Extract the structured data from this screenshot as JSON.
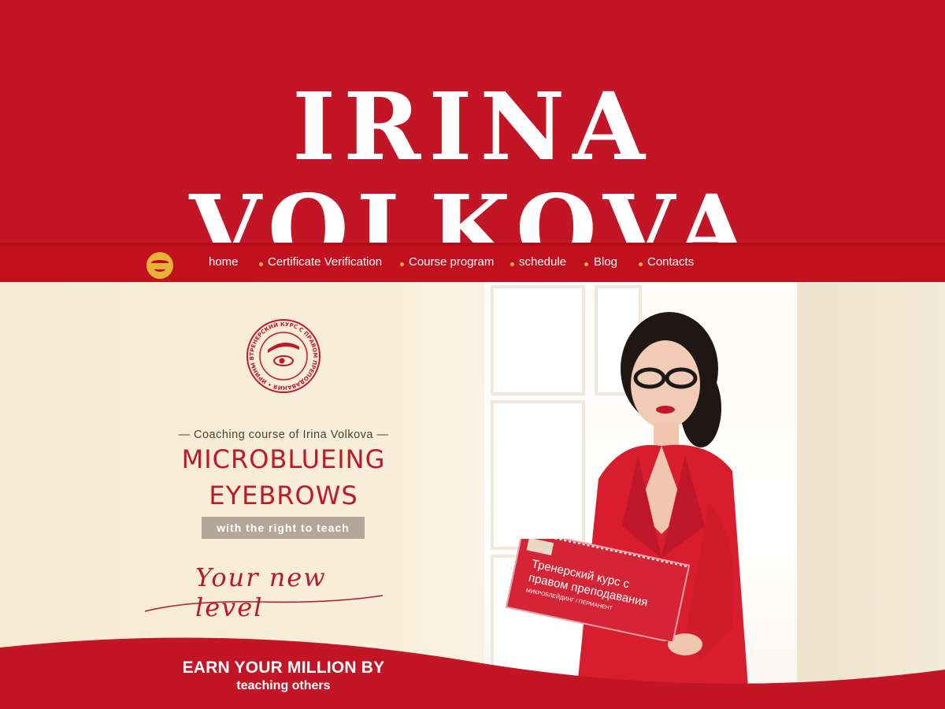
{
  "banner": {
    "title": "Irina Volkova"
  },
  "nav": {
    "logo_icon": "eyebrow-eye-icon",
    "items": [
      {
        "label": "home"
      },
      {
        "label": "Certificate Verification"
      },
      {
        "label": "Course program"
      },
      {
        "label": "schedule"
      },
      {
        "label": "Blog"
      },
      {
        "label": "Contacts"
      }
    ]
  },
  "hero": {
    "stamp_text": "ТРЕНЕРСКИЙ КУРС С ПРАВОМ ПРЕПОДАВАНИЯ • ИРИНЫ ВОЛКОВОЙ •",
    "subtitle": "— Coaching course of Irina Volkova —",
    "title_line1": "MICROBLUEING",
    "title_line2": "EYEBROWS",
    "badge": "with the right to teach",
    "script": "Your new level",
    "book_line1": "Тренерский курс с",
    "book_line2": "правом преподавания",
    "book_line3": "МИКРОБЛЕЙДИНГ / ПЕРМАНЕНТ"
  },
  "cta": {
    "line1": "EARN YOUR MILLION BY",
    "line2": "teaching others"
  },
  "colors": {
    "brand_red": "#c21526",
    "nav_dot": "#f1b44a",
    "logo_gold": "#e8b23a",
    "badge_gray": "#b4a79a",
    "cream": "#f6ead2"
  }
}
